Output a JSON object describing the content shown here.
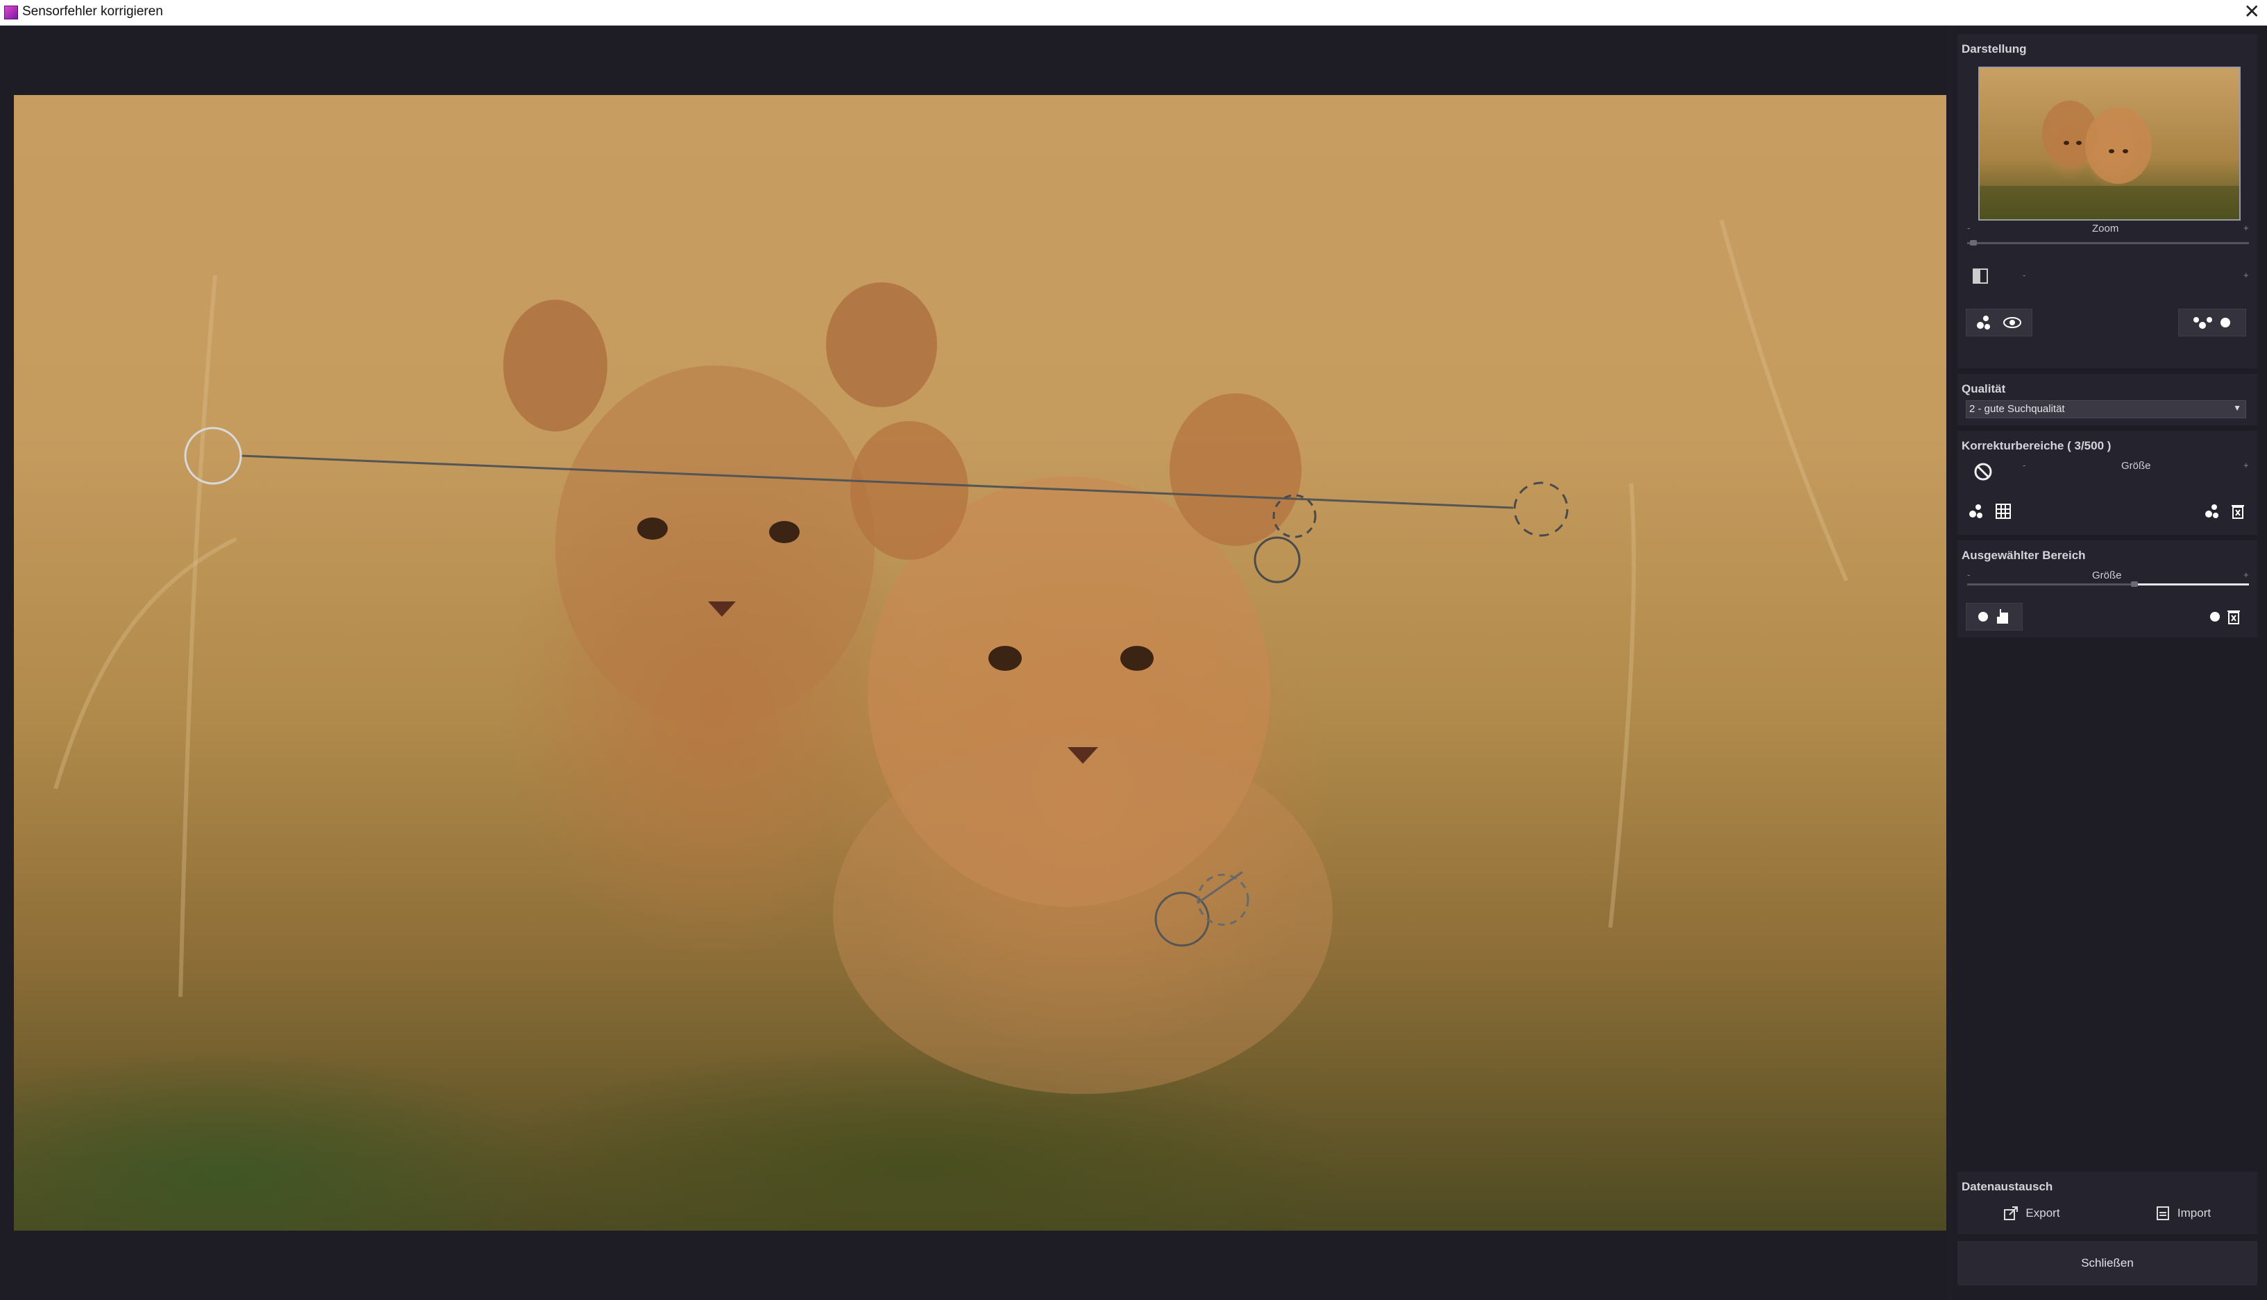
{
  "window": {
    "title": "Sensorfehler korrigieren",
    "close_icon": "close-icon"
  },
  "panel": {
    "darstellung": {
      "title": "Darstellung",
      "zoom_label": "Zoom",
      "zoom_minus": "-",
      "zoom_plus": "+",
      "slider2_minus": "-",
      "slider2_plus": "+"
    },
    "qualitaet": {
      "title": "Qualität",
      "selected": "2 - gute Suchqualität"
    },
    "korrektur": {
      "title": "Korrekturbereiche  ( 3/500 )",
      "size_label": "Größe",
      "minus": "-",
      "plus": "+"
    },
    "ausgewaehlt": {
      "title": "Ausgewählter Bereich",
      "size_label": "Größe",
      "minus": "-",
      "plus": "+",
      "size_level": 0.6
    },
    "datenaustausch": {
      "title": "Datenaustausch",
      "export_label": "Export",
      "import_label": "Import"
    },
    "close_label": "Schließen"
  },
  "colors": {
    "panel_bg": "#1e1d26",
    "section_bg": "#25242e",
    "accent_white": "#e6e6ea"
  }
}
